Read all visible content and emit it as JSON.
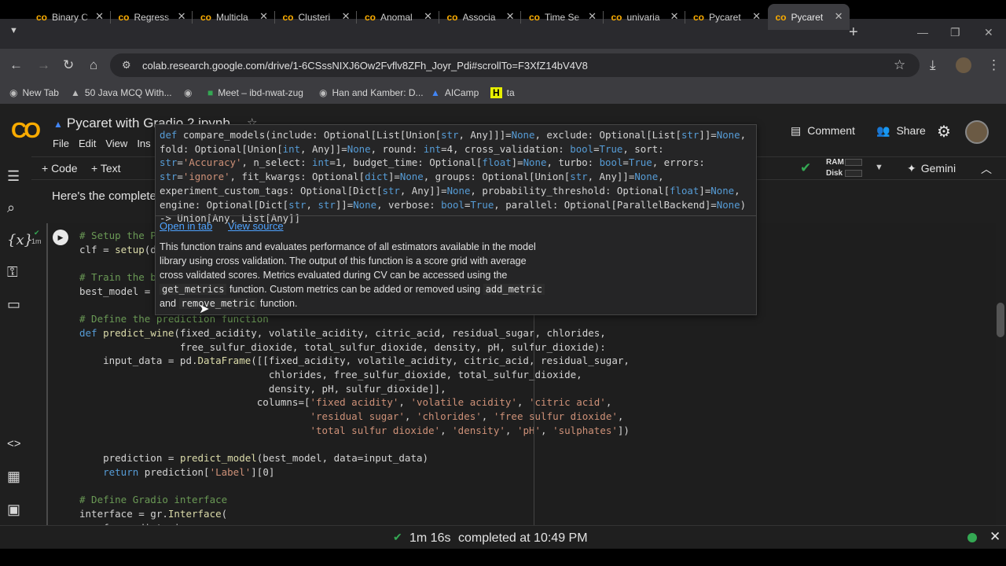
{
  "browser": {
    "tabs": [
      {
        "title": "Binary C",
        "active": false
      },
      {
        "title": "Regress",
        "active": false
      },
      {
        "title": "Multicla",
        "active": false
      },
      {
        "title": "Clusteri",
        "active": false
      },
      {
        "title": "Anomal",
        "active": false
      },
      {
        "title": "Associa",
        "active": false
      },
      {
        "title": "Time Se",
        "active": false
      },
      {
        "title": "univaria",
        "active": false
      },
      {
        "title": "Pycaret",
        "active": false
      },
      {
        "title": "Pycaret",
        "active": true
      }
    ],
    "url": "colab.research.google.com/drive/1-6CSssNIXJ6Ow2Fvflv8ZFh_Joyr_Pdi#scrollTo=F3XfZ14bV4V8",
    "bookmarks": [
      {
        "icon": "globe-icon",
        "label": "New Tab"
      },
      {
        "icon": "mountain-icon",
        "label": "50 Java MCQ With..."
      },
      {
        "icon": "globe-icon",
        "label": ""
      },
      {
        "icon": "meet-icon",
        "label": "Meet – ibd-nwat-zug"
      },
      {
        "icon": "globe-icon",
        "label": "Han and Kamber: D..."
      },
      {
        "icon": "aicamp-icon",
        "label": "AICamp"
      },
      {
        "icon": "h-icon",
        "label": "ta"
      }
    ]
  },
  "colab": {
    "logo": "CO",
    "title": "Pycaret with Gradio 2.ipynb",
    "menu": [
      "File",
      "Edit",
      "View",
      "Ins"
    ],
    "comment_label": "Comment",
    "share_label": "Share",
    "add_code": "+ Code",
    "add_text": "+ Text",
    "ram_label": "RAM",
    "disk_label": "Disk",
    "gemini_label": "Gemini",
    "intro_text": "Here's the complete",
    "cell_runtime": "1m"
  },
  "code_lines": [
    "# Setup the P",
    "clf = setup(d",
    "",
    "# Train the b",
    "best_model = ",
    "",
    "# Define the prediction function",
    "def predict_wine(fixed_acidity, volatile_acidity, citric_acid, residual_sugar, chlorides,",
    "                 free_sulfur_dioxide, total_sulfur_dioxide, density, pH, sulfur_dioxide):",
    "    input_data = pd.DataFrame([[fixed_acidity, volatile_acidity, citric_acid, residual_sugar,",
    "                                chlorides, free_sulfur_dioxide, total_sulfur_dioxide,",
    "                                density, pH, sulfur_dioxide]],",
    "                              columns=['fixed acidity', 'volatile acidity', 'citric acid',",
    "                                       'residual sugar', 'chlorides', 'free sulfur dioxide',",
    "                                       'total sulfur dioxide', 'density', 'pH', 'sulphates'])",
    "",
    "    prediction = predict_model(best_model, data=input_data)",
    "    return prediction['Label'][0]",
    "",
    "# Define Gradio interface",
    "interface = gr.Interface(",
    "    fn=predict_wine,"
  ],
  "tooltip": {
    "signature": "def compare_models(include: Optional[List[Union[str, Any]]]=None, exclude: Optional[List[str]]=None, fold: Optional[Union[int, Any]]=None, round: int=4, cross_validation: bool=True, sort: str='Accuracy', n_select: int=1, budget_time: Optional[float]=None, turbo: bool=True, errors: str='ignore', fit_kwargs: Optional[dict]=None, groups: Optional[Union[str, Any]]=None, experiment_custom_tags: Optional[Dict[str, Any]]=None, probability_threshold: Optional[float]=None, engine: Optional[Dict[str, str]]=None, verbose: bool=True, parallel: Optional[ParallelBackend]=None) -> Union[Any, List[Any]]",
    "open_in_tab": "Open in tab",
    "view_source": "View source",
    "doc_part1": "This function trains and evaluates performance of all estimators available in the model library using cross validation. The output of this function is a score grid with average cross validated scores. Metrics evaluated during CV can be accessed using the ",
    "doc_code1": "get_metrics",
    "doc_part2": " function. Custom metrics can be added or removed using ",
    "doc_code2": "add_metric",
    "doc_part3": " and ",
    "doc_code3": "remove_metric",
    "doc_part4": " function."
  },
  "status": {
    "duration": "1m 16s",
    "message": "completed at 10:49 PM"
  }
}
